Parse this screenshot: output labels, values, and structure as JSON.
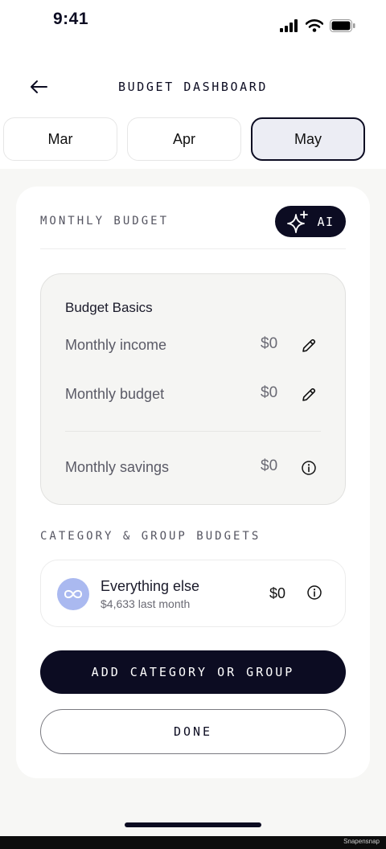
{
  "status_bar": {
    "time": "9:41"
  },
  "header": {
    "title": "BUDGET DASHBOARD"
  },
  "months": [
    {
      "label": "Mar",
      "active": false
    },
    {
      "label": "Apr",
      "active": false
    },
    {
      "label": "May",
      "active": true
    }
  ],
  "monthly_budget": {
    "section_label": "MONTHLY BUDGET",
    "ai_label": "AI",
    "basics_title": "Budget Basics",
    "rows": [
      {
        "label": "Monthly income",
        "value": "$0",
        "icon": "pencil-icon"
      },
      {
        "label": "Monthly budget",
        "value": "$0",
        "icon": "pencil-icon"
      },
      {
        "label": "Monthly savings",
        "value": "$0",
        "icon": "info-icon"
      }
    ]
  },
  "category_budgets": {
    "section_label": "CATEGORY & GROUP BUDGETS",
    "group": {
      "name": "Everything else",
      "subtitle": "$4,633 last month",
      "value": "$0",
      "icon": "infinity-icon"
    }
  },
  "actions": {
    "add_label": "ADD CATEGORY OR GROUP",
    "done_label": "DONE"
  },
  "footer": {
    "watermark": "Snapensnap"
  },
  "colors": {
    "navy": "#0c0c22",
    "active_tab_bg": "#ecedf4",
    "avatar_bg": "#aab9f0",
    "page_bg": "#f7f7f5"
  }
}
